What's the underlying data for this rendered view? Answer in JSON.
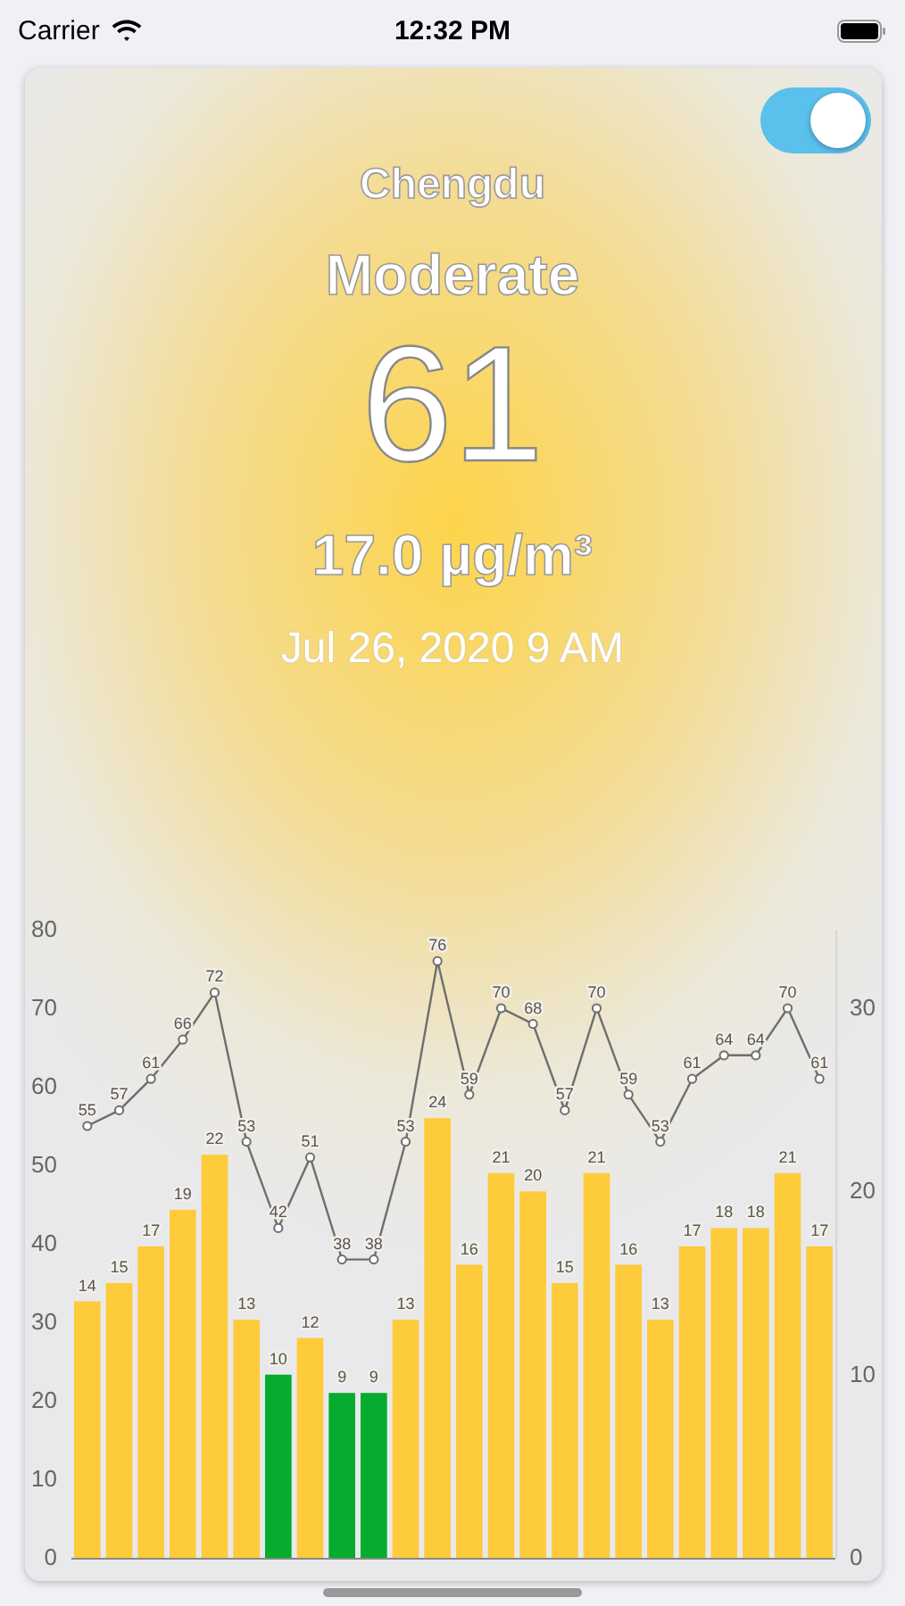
{
  "status_bar": {
    "carrier": "Carrier",
    "time": "12:32 PM"
  },
  "card": {
    "toggle": {
      "on": true
    },
    "city": "Chengdu",
    "category": "Moderate",
    "aqi": "61",
    "concentration": "17.0 µg/m³",
    "timestamp": "Jul 26, 2020 9 AM",
    "chart_data": {
      "type": "bar",
      "data_labels": true,
      "ylim": [
        0,
        80
      ],
      "yticks": [
        0,
        10,
        20,
        30,
        40,
        50,
        60,
        70,
        80
      ],
      "y2lim": [
        0,
        34.29
      ],
      "y2ticks": [
        0,
        10,
        20,
        30
      ],
      "series": [
        {
          "axis": "y2",
          "color": "#fecb3a",
          "values": [
            14,
            15,
            17,
            19,
            22,
            13,
            null,
            12,
            null,
            null,
            13,
            24,
            16,
            21,
            20,
            15,
            21,
            16,
            13,
            17,
            18,
            18,
            21,
            17
          ]
        },
        {
          "axis": "y2",
          "color": "#05ac2d",
          "values": [
            null,
            null,
            null,
            null,
            null,
            null,
            10,
            null,
            9,
            9,
            null,
            null,
            null,
            null,
            null,
            null,
            null,
            null,
            null,
            null,
            null,
            null,
            null,
            null
          ]
        },
        {
          "type": "line",
          "marker": "circle",
          "color": "#6e6e6e",
          "values": [
            55,
            57,
            61,
            66,
            72,
            53,
            42,
            51,
            38,
            38,
            53,
            76,
            59,
            70,
            68,
            57,
            70,
            59,
            53,
            61,
            64,
            64,
            70,
            61
          ]
        }
      ]
    }
  }
}
